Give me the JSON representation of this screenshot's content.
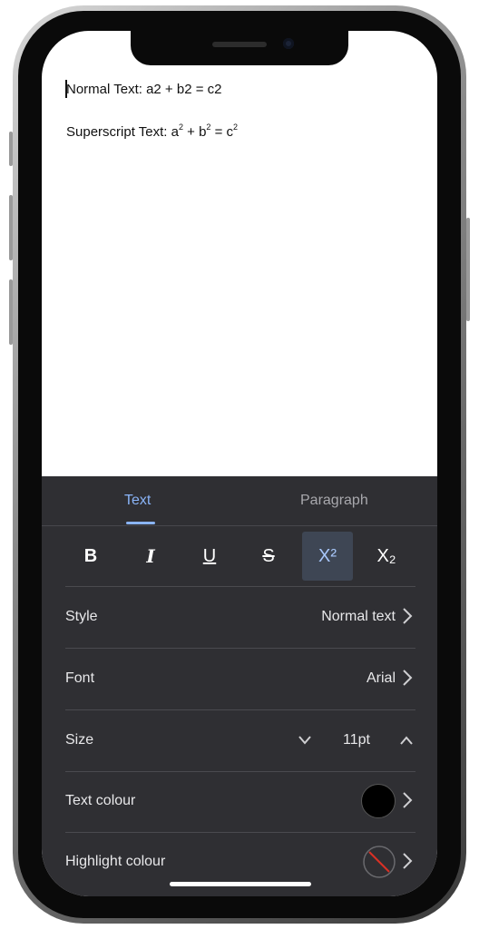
{
  "document": {
    "line1": "Normal Text: a2 + b2 = c2",
    "line2": {
      "prefix": "Superscript Text: a",
      "sup": "2",
      "plus": " + b",
      "eq": " = c"
    }
  },
  "panel": {
    "tabs": [
      {
        "label": "Text",
        "active": true
      },
      {
        "label": "Paragraph",
        "active": false
      }
    ],
    "format_buttons": [
      {
        "label": "B",
        "name": "bold",
        "active": false
      },
      {
        "label": "I",
        "name": "italic",
        "active": false
      },
      {
        "label": "U",
        "name": "underline",
        "active": false
      },
      {
        "label": "S",
        "name": "strikethrough",
        "active": false
      },
      {
        "label": "X²",
        "name": "superscript",
        "active": true
      },
      {
        "label": "X₂",
        "name": "subscript",
        "active": false
      }
    ],
    "style": {
      "label": "Style",
      "value": "Normal text"
    },
    "font": {
      "label": "Font",
      "value": "Arial"
    },
    "size": {
      "label": "Size",
      "value": "11pt"
    },
    "text_colour": {
      "label": "Text colour",
      "color": "#000000"
    },
    "highlight_colour": {
      "label": "Highlight colour",
      "color": "none"
    }
  },
  "colors": {
    "accent": "#8ab4f8",
    "panel_bg": "#2f2f33",
    "active_btn_bg": "#3e4654"
  },
  "icons": {
    "chevron_right": "chevron-right-icon",
    "chevron_down": "chevron-down-icon",
    "chevron_up": "chevron-up-icon",
    "no_color": "no-color-icon"
  }
}
